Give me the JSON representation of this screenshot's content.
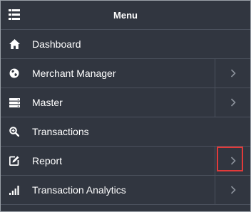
{
  "menu": {
    "title": "Menu",
    "header_icon": "list-icon",
    "items": [
      {
        "label": "Dashboard",
        "icon": "home-icon",
        "has_submenu": false
      },
      {
        "label": "Merchant Manager",
        "icon": "globe-icon",
        "has_submenu": true
      },
      {
        "label": "Master",
        "icon": "server-icon",
        "has_submenu": true
      },
      {
        "label": "Transactions",
        "icon": "search-zoom-icon",
        "has_submenu": false
      },
      {
        "label": "Report",
        "icon": "edit-icon",
        "has_submenu": true,
        "highlighted": true
      },
      {
        "label": "Transaction Analytics",
        "icon": "signal-bars-icon",
        "has_submenu": true
      }
    ]
  },
  "colors": {
    "background": "#313640",
    "divider": "#4b515d",
    "text": "#ffffff",
    "chevron": "#8b919b",
    "highlight": "#e23a3a"
  }
}
